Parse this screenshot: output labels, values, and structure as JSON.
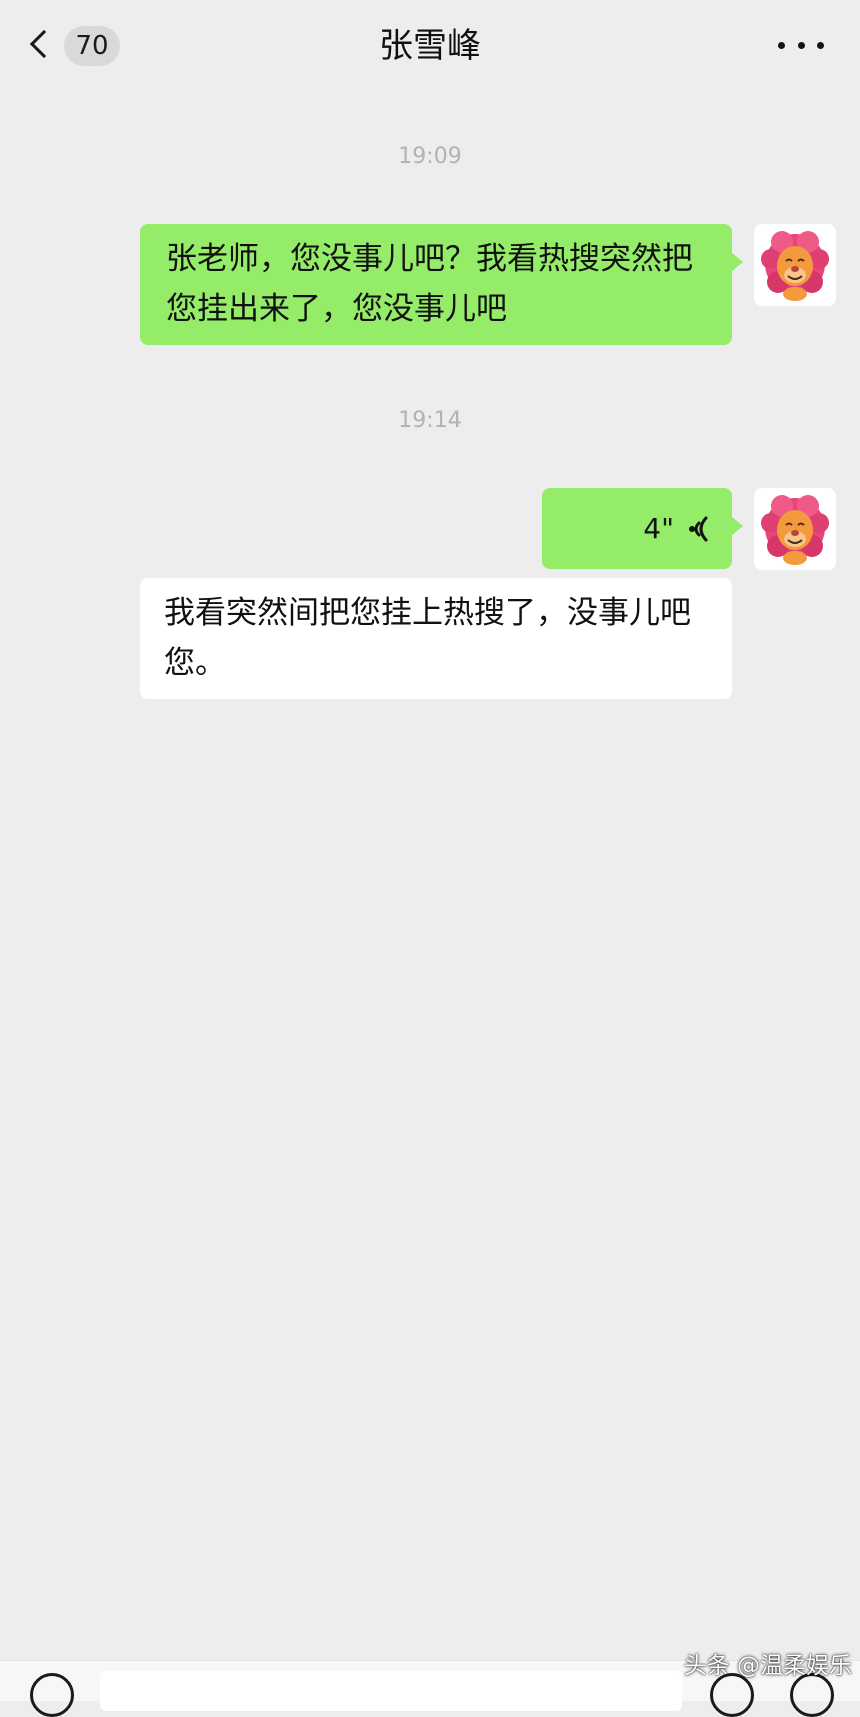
{
  "header": {
    "unread_count": "70",
    "title": "张雪峰"
  },
  "messages": [
    {
      "time": "19:09",
      "sender": "self",
      "type": "text",
      "text": "张老师，您没事儿吧？我看热搜突然把您挂出来了，您没事儿吧"
    },
    {
      "time": "19:14",
      "sender": "self",
      "type": "voice",
      "duration": "4\""
    },
    {
      "sender": "self",
      "type": "voice-transcript",
      "text": "我看突然间把您挂上热搜了，没事儿吧您。"
    }
  ],
  "watermark": "头条 @温柔娱乐",
  "colors": {
    "background": "#ededed",
    "self_bubble": "#95ec69",
    "transcript_bubble": "#ffffff",
    "timestamp_text": "#b2b2b2"
  },
  "icons": {
    "back": "chevron-left-icon",
    "more": "more-dots-icon",
    "voice_wave": "voice-wave-icon",
    "avatar": "lion-avatar"
  }
}
